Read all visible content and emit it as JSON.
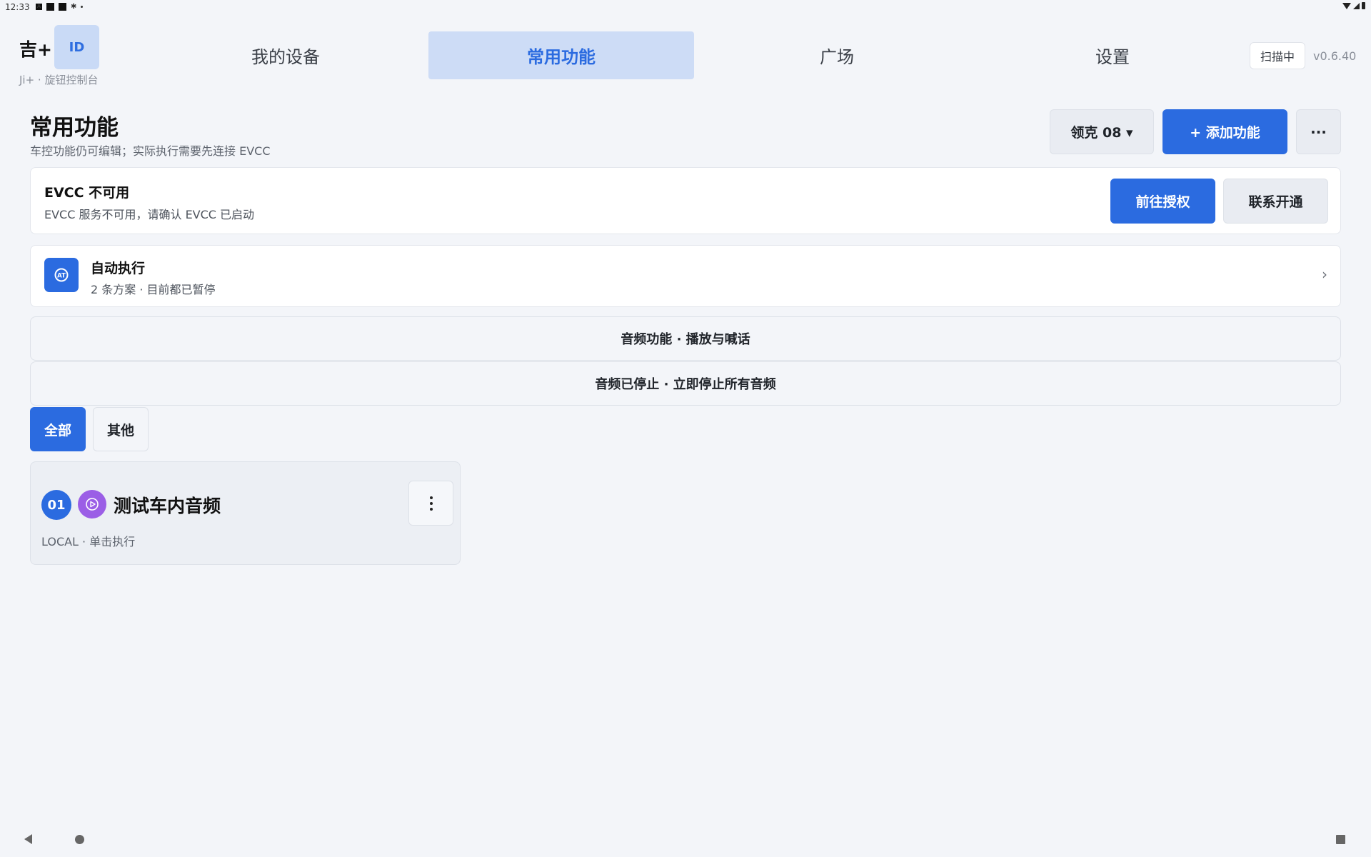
{
  "status_bar": {
    "time": "12:33"
  },
  "header": {
    "logo": "吉+",
    "id_badge": "ID",
    "brand_subtitle": "Ji+ · 旋钮控制台",
    "tabs": [
      {
        "label": "我的设备",
        "active": false
      },
      {
        "label": "常用功能",
        "active": true
      },
      {
        "label": "广场",
        "active": false
      },
      {
        "label": "设置",
        "active": false
      }
    ],
    "scan_label": "扫描中",
    "version": "v0.6.40"
  },
  "page": {
    "title": "常用功能",
    "subtitle": "车控功能仍可编辑；实际执行需要先连接 EVCC",
    "vehicle_selector": "领克 08 ▾",
    "add_button": "+ 添加功能",
    "more_button": "···"
  },
  "evcc_card": {
    "title": "EVCC 不可用",
    "subtitle": "EVCC 服务不可用，请确认 EVCC 已启动",
    "authorize_button": "前往授权",
    "contact_button": "联系开通"
  },
  "auto_card": {
    "title": "自动执行",
    "subtitle": "2 条方案 · 目前都已暂停",
    "chevron": "›"
  },
  "audio_bar": "音频功能 · 播放与喊话",
  "stop_bar": "音频已停止 · 立即停止所有音频",
  "filters": [
    {
      "label": "全部",
      "active": true
    },
    {
      "label": "其他",
      "active": false
    }
  ],
  "functions": [
    {
      "index": "01",
      "name": "测试车内音频",
      "meta": "LOCAL · 单击执行"
    }
  ],
  "colors": {
    "accent": "#2b6be0",
    "accent_light": "#cddcf6",
    "purple": "#9b5ee6",
    "background": "#f3f5f9"
  }
}
